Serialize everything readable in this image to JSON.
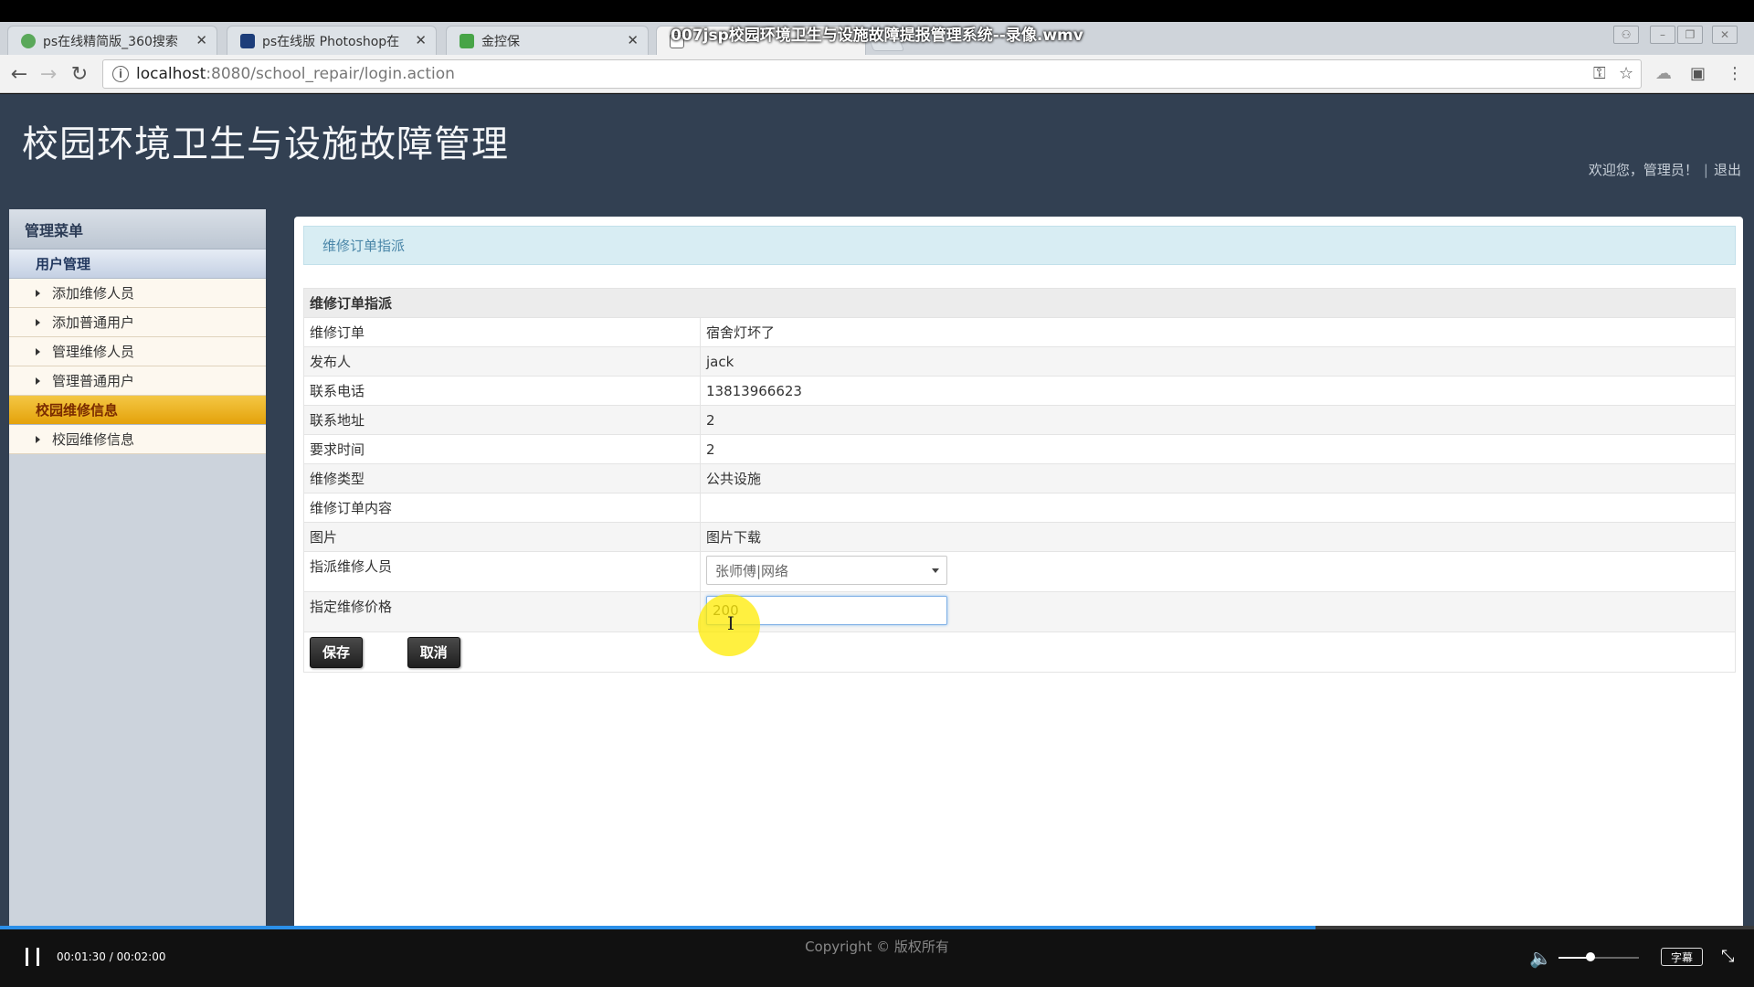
{
  "video": {
    "title": "007jsp校园环境卫生与设施故障提报管理系统--录像.wmv",
    "time": "00:01:30 / 00:02:00",
    "progress": 0.75,
    "volume": 0.4,
    "subtitle_button": "字幕",
    "footer": "Copyright © 版权所有"
  },
  "browser": {
    "tabs": [
      {
        "title": "ps在线精简版_360搜索",
        "icon": "globe-icon",
        "color": "#5aa85a"
      },
      {
        "title": "ps在线版 Photoshop在",
        "icon": "ps-icon",
        "color": "#1c3d7a"
      },
      {
        "title": "金控保",
        "icon": "leaf-icon",
        "color": "#47a447"
      },
      {
        "title": "",
        "icon": "page-icon",
        "color": "#666666"
      }
    ],
    "url_host": "localhost",
    "url_path": ":8080/school_repair/login.action"
  },
  "header": {
    "site_title": "校园环境卫生与设施故障管理",
    "welcome": "欢迎您，管理员！",
    "logout": "退出"
  },
  "sidebar": {
    "title": "管理菜单",
    "groups": [
      {
        "label": "用户管理",
        "items": [
          "添加维修人员",
          "添加普通用户",
          "管理维修人员",
          "管理普通用户"
        ]
      },
      {
        "label": "校园维修信息",
        "items": [
          "校园维修信息"
        ]
      }
    ]
  },
  "main": {
    "breadcrumb": "维修订单指派",
    "form_title": "维修订单指派",
    "fields": [
      {
        "label": "维修订单",
        "value": "宿舍灯坏了"
      },
      {
        "label": "发布人",
        "value": "jack"
      },
      {
        "label": "联系电话",
        "value": "13813966623"
      },
      {
        "label": "联系地址",
        "value": "2"
      },
      {
        "label": "要求时间",
        "value": "2"
      },
      {
        "label": "维修类型",
        "value": "公共设施"
      },
      {
        "label": "维修订单内容",
        "value": ""
      },
      {
        "label": "图片",
        "value": "图片下载"
      }
    ],
    "assign_label": "指派维修人员",
    "assign_selected": "张师傅|网络",
    "price_label": "指定维修价格",
    "price_value": "200",
    "save_label": "保存",
    "cancel_label": "取消"
  },
  "colors": {
    "page_bg": "#324052",
    "active_group": "#e4a20b",
    "progress": "#2b8fe8"
  }
}
